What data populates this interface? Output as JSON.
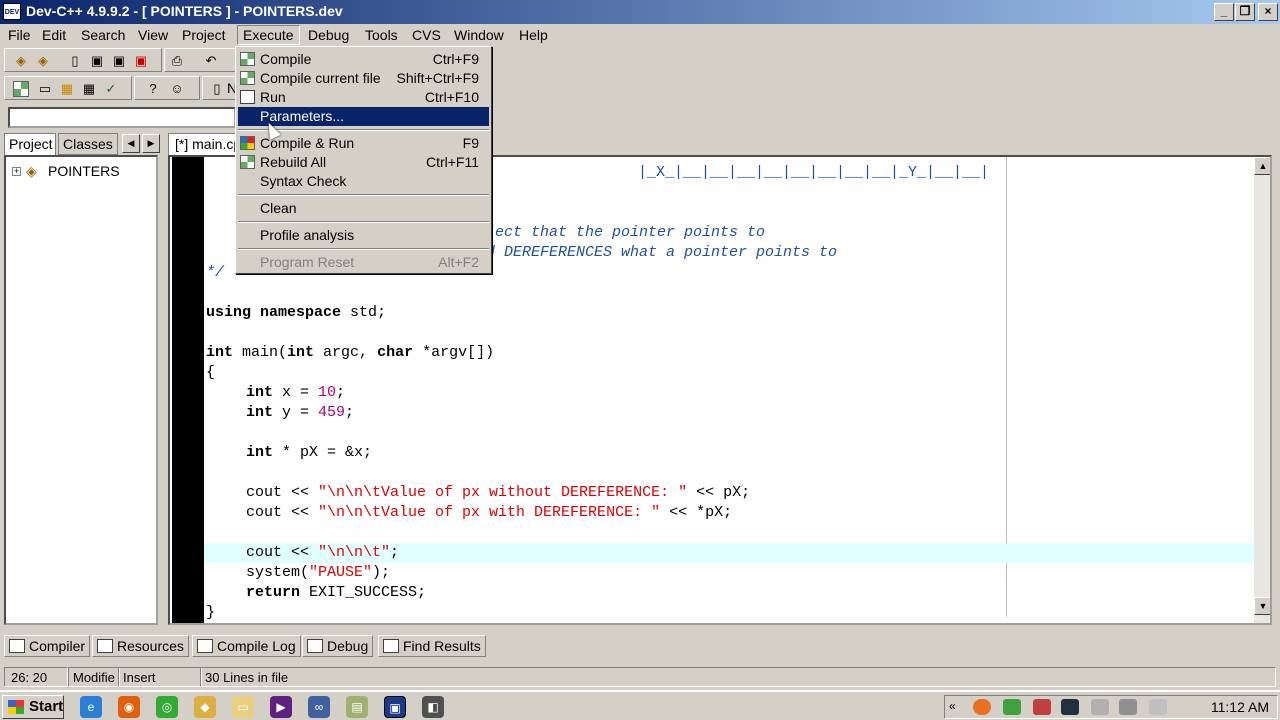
{
  "window": {
    "title": "Dev-C++ 4.9.9.2  - [ POINTERS ] - POINTERS.dev",
    "app_icon": "DEV"
  },
  "menubar": [
    "File",
    "Edit",
    "Search",
    "View",
    "Project",
    "Execute",
    "Debug",
    "Tools",
    "CVS",
    "Window",
    "Help"
  ],
  "execute_menu": {
    "items": [
      {
        "label": "Compile",
        "shortcut": "Ctrl+F9",
        "icon": "compile-icon"
      },
      {
        "label": "Compile current file",
        "shortcut": "Shift+Ctrl+F9",
        "icon": "compile-file-icon"
      },
      {
        "label": "Run",
        "shortcut": "Ctrl+F10",
        "icon": "run-icon"
      },
      {
        "label": "Parameters...",
        "shortcut": "",
        "icon": ""
      },
      {
        "label": "Compile & Run",
        "shortcut": "F9",
        "icon": "compile-run-icon"
      },
      {
        "label": "Rebuild All",
        "shortcut": "Ctrl+F11",
        "icon": "rebuild-icon"
      },
      {
        "label": "Syntax Check",
        "shortcut": "",
        "icon": ""
      },
      {
        "label": "Clean",
        "shortcut": "",
        "icon": ""
      },
      {
        "label": "Profile analysis",
        "shortcut": "",
        "icon": ""
      },
      {
        "label": "Program Reset",
        "shortcut": "Alt+F2",
        "icon": ""
      }
    ]
  },
  "left_panel": {
    "tabs": [
      "Project",
      "Classes"
    ],
    "project_name": "POINTERS"
  },
  "editor": {
    "tab_label": "[*] main.cpp",
    "partial_tab_n": "N",
    "code": {
      "diagram": "|_X_|__|__|__|__|__|__|__|__|_Y_|__|__|",
      "c1": "ject that the pointer points to",
      "c2": "d DEREFERENCES what a pointer points to",
      "c3": "*/",
      "l_using_kw": "using namespace",
      "l_using_rest": " std;",
      "l_main_int": "int",
      "l_main_a": " main(",
      "l_main_int2": "int",
      "l_main_b": " argc, ",
      "l_main_char": "char",
      "l_main_c": " *argv[])",
      "brace_open": "{",
      "x_kw": "int",
      "x_a": " x = ",
      "x_num": "10",
      "x_end": ";",
      "y_kw": "int",
      "y_a": " y = ",
      "y_num": "459",
      "y_end": ";",
      "px_kw": "int",
      "px_rest": " * pX = &x;",
      "cout1_a": "cout << ",
      "cout1_str": "\"\\n\\n\\tValue of px without DEREFERENCE: \"",
      "cout1_b": " << pX;",
      "cout2_a": "cout << ",
      "cout2_str": "\"\\n\\n\\tValue of px with DEREFERENCE: \"",
      "cout2_b": " << *pX;",
      "cout3_a": "cout << ",
      "cout3_str": "\"\\n\\n\\t\"",
      "cout3_b": ";",
      "sys_a": "system(",
      "sys_str": "\"PAUSE\"",
      "sys_b": ");",
      "ret_kw": "return",
      "ret_rest": " EXIT_SUCCESS;",
      "brace_close": "}"
    }
  },
  "bottom_tabs": [
    "Compiler",
    "Resources",
    "Compile Log",
    "Debug",
    "Find Results"
  ],
  "status": {
    "position": "26: 20",
    "modified": "Modifie",
    "mode": "Insert",
    "lines": "30 Lines in file"
  },
  "taskbar": {
    "start": "Start",
    "clock": "11:12 AM"
  }
}
